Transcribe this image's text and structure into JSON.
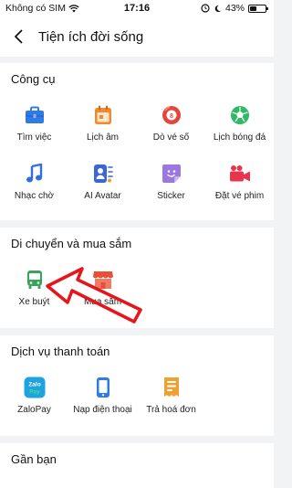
{
  "status_bar": {
    "carrier": "Không có SIM",
    "time": "17:16",
    "battery": "43%",
    "battery_level": 0.43
  },
  "header": {
    "title": "Tiện ích đời sống"
  },
  "sections": {
    "tools": {
      "title": "Công cụ",
      "items": [
        {
          "label": "Tìm việc",
          "icon": "briefcase-icon",
          "color": "#2f7be5"
        },
        {
          "label": "Lịch âm",
          "icon": "calendar-icon",
          "color": "#f08a2a"
        },
        {
          "label": "Dò vé số",
          "icon": "lottery-ball-icon",
          "color": "#e5443a"
        },
        {
          "label": "Lịch bóng đá",
          "icon": "soccer-ball-icon",
          "color": "#2fb866"
        },
        {
          "label": "Nhạc chờ",
          "icon": "music-note-icon",
          "color": "#2f6fe0"
        },
        {
          "label": "AI Avatar",
          "icon": "ai-avatar-icon",
          "color": "#3a66d8"
        },
        {
          "label": "Sticker",
          "icon": "sticker-icon",
          "color": "#8a63d8"
        },
        {
          "label": "Đặt vé phim",
          "icon": "movie-camera-icon",
          "color": "#e8354e"
        }
      ]
    },
    "travel": {
      "title": "Di chuyển và mua sắm",
      "items": [
        {
          "label": "Xe buýt",
          "icon": "bus-icon",
          "color": "#3aa35a"
        },
        {
          "label": "Mua sắm",
          "icon": "shop-icon",
          "color": "#e8503a"
        }
      ]
    },
    "payment": {
      "title": "Dịch vụ thanh toán",
      "items": [
        {
          "label": "ZaloPay",
          "icon": "zalopay-icon",
          "color": "#1fa3e0",
          "logo_text_1": "Zalo",
          "logo_text_2": "Pay"
        },
        {
          "label": "Nạp điện thoại",
          "icon": "phone-topup-icon",
          "color": "#2f7be5"
        },
        {
          "label": "Trả hoá đơn",
          "icon": "bill-icon",
          "color": "#f0a030"
        }
      ]
    },
    "nearby": {
      "title": "Gần bạn"
    }
  },
  "annotation": {
    "arrow_color": "#e8141c"
  }
}
